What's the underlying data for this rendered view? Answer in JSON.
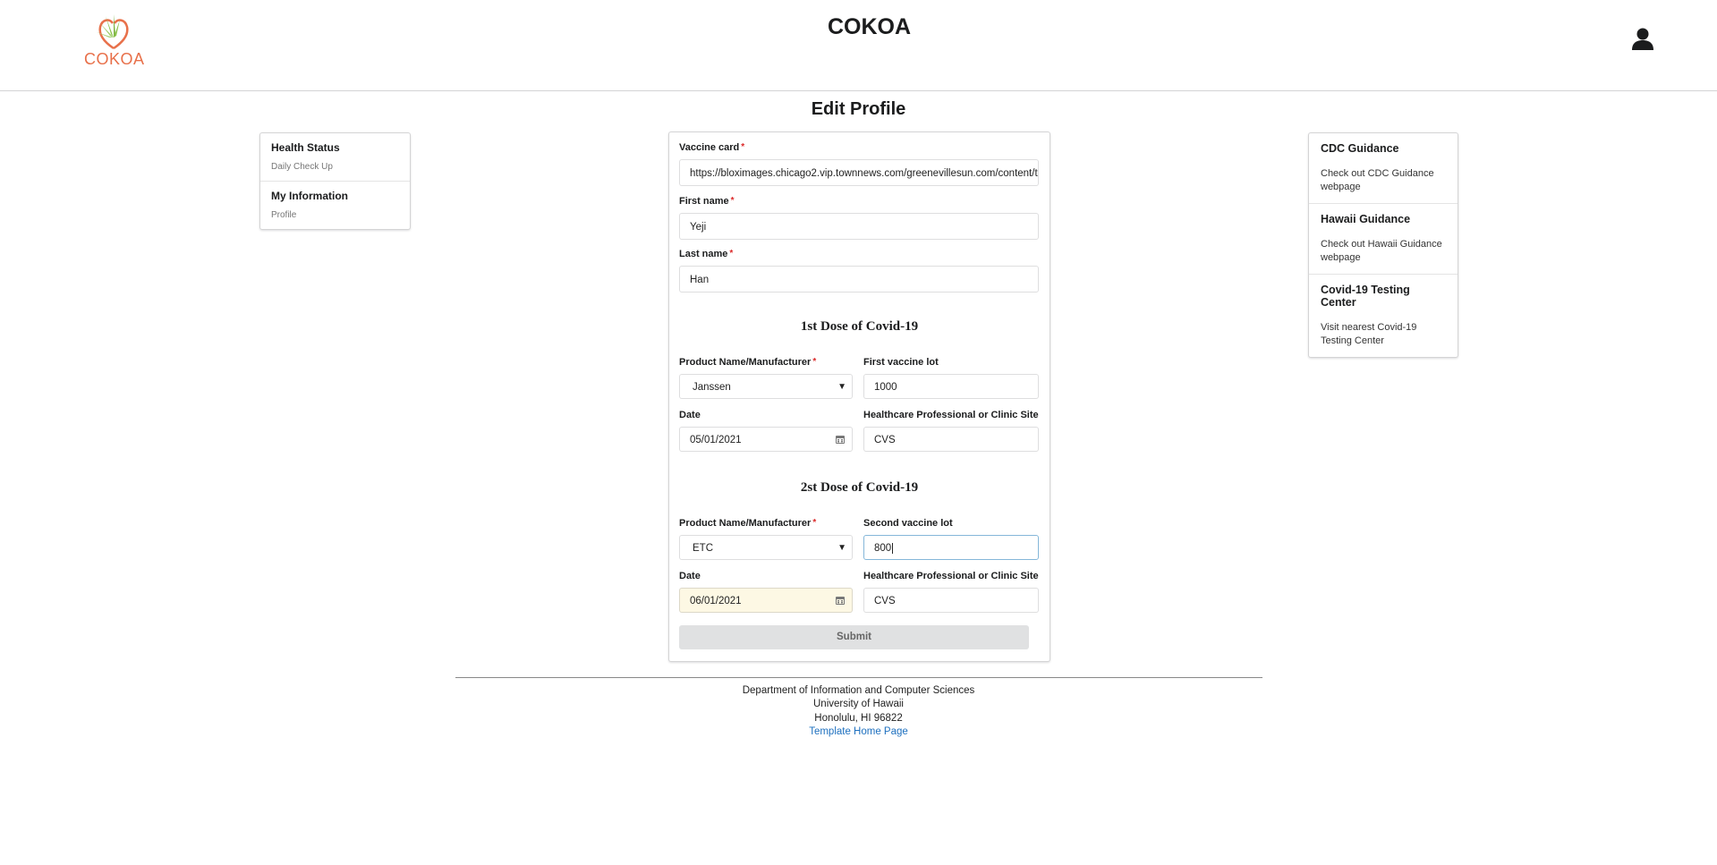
{
  "header": {
    "logo_text": "COKOA",
    "title": "COKOA",
    "user_icon": "user-icon"
  },
  "page_title": "Edit Profile",
  "left_menu": {
    "items": [
      {
        "title": "Health Status",
        "subtitle": "Daily Check Up"
      },
      {
        "title": "My Information",
        "subtitle": "Profile"
      }
    ]
  },
  "right_menu": {
    "items": [
      {
        "title": "CDC Guidance",
        "subtitle": "Check out CDC Guidance webpage"
      },
      {
        "title": "Hawaii Guidance",
        "subtitle": "Check out Hawaii Guidance webpage"
      },
      {
        "title": "Covid-19 Testing Center",
        "subtitle": "Visit nearest Covid-19 Testing Center"
      }
    ]
  },
  "form": {
    "vaccine_card_label": "Vaccine card",
    "vaccine_card_value": "https://bloximages.chicago2.vip.townnews.com/greenevillesun.com/content/t",
    "first_name_label": "First name",
    "first_name_value": "Yeji",
    "last_name_label": "Last name",
    "last_name_value": "Han",
    "dose1": {
      "title": "1st Dose of Covid-19",
      "product_label": "Product Name/Manufacturer",
      "product_value": "Janssen",
      "lot_label": "First vaccine lot",
      "lot_value": "1000",
      "date_label": "Date",
      "date_value": "05/01/2021",
      "site_label": "Healthcare Professional or Clinic Site",
      "site_value": "CVS"
    },
    "dose2": {
      "title": "2st Dose of Covid-19",
      "product_label": "Product Name/Manufacturer",
      "product_value": "ETC",
      "lot_label": "Second vaccine lot",
      "lot_value": "800",
      "date_label": "Date",
      "date_value": "06/01/2021",
      "site_label": "Healthcare Professional or Clinic Site",
      "site_value": "CVS"
    },
    "submit_label": "Submit",
    "required_mark": "*"
  },
  "footer": {
    "line1": "Department of Information and Computer Sciences",
    "line2": "University of Hawaii",
    "line3": "Honolulu, HI 96822",
    "link": "Template Home Page"
  },
  "colors": {
    "brand_orange": "#e8704a",
    "brand_green": "#8bc34a",
    "link_blue": "#1e70bf",
    "required_red": "#db2828"
  }
}
